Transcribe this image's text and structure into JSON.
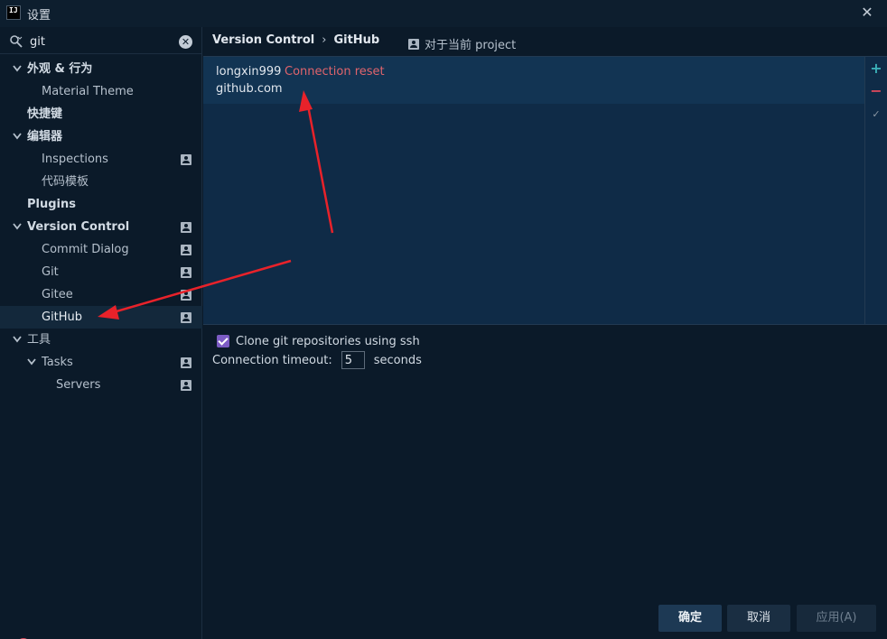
{
  "window": {
    "title": "设置",
    "logo_text": "IJ"
  },
  "search": {
    "value": "git"
  },
  "tree": [
    {
      "label": "外观 & 行为",
      "bold": true,
      "expandable": true
    },
    {
      "label": "Material Theme"
    },
    {
      "label": "快捷键",
      "bold": true
    },
    {
      "label": "编辑器",
      "bold": true,
      "expandable": true
    },
    {
      "label": "Inspections",
      "project_icon": true
    },
    {
      "label": "代码模板"
    },
    {
      "label": "Plugins",
      "bold": true
    },
    {
      "label": "Version Control",
      "bold": true,
      "expandable": true,
      "project_icon": true
    },
    {
      "label": "Commit Dialog",
      "project_icon": true
    },
    {
      "label": "Git",
      "project_icon": true
    },
    {
      "label": "Gitee",
      "project_icon": true
    },
    {
      "label": "GitHub",
      "project_icon": true,
      "selected": true
    },
    {
      "label": "工具",
      "expandable": true
    },
    {
      "label": "Tasks",
      "expandable": true,
      "project_icon": true
    },
    {
      "label": "Servers",
      "project_icon": true
    }
  ],
  "breadcrumb": {
    "parent": "Version Control",
    "separator": "›",
    "current": "GitHub"
  },
  "scope_label": "对于当前 project",
  "account": {
    "name": "longxin999",
    "error": "Connection reset",
    "host": "github.com"
  },
  "toolbar": {
    "add": "+",
    "remove": "−",
    "default": "✓"
  },
  "options": {
    "clone_ssh_label": "Clone git repositories using ssh",
    "clone_ssh_checked": true,
    "timeout_label": "Connection timeout:",
    "timeout_value": "5",
    "timeout_unit": "seconds"
  },
  "footer": {
    "help": "?",
    "ok": "确定",
    "cancel": "取消",
    "apply": "应用(A)"
  },
  "colors": {
    "background": "#0b1a29",
    "panel": "#0f2b47",
    "error": "#e0646c",
    "checkbox": "#7c5cc4",
    "add": "#3bb0b8",
    "remove": "#d8485a",
    "annotation_arrow": "#e8222a"
  }
}
